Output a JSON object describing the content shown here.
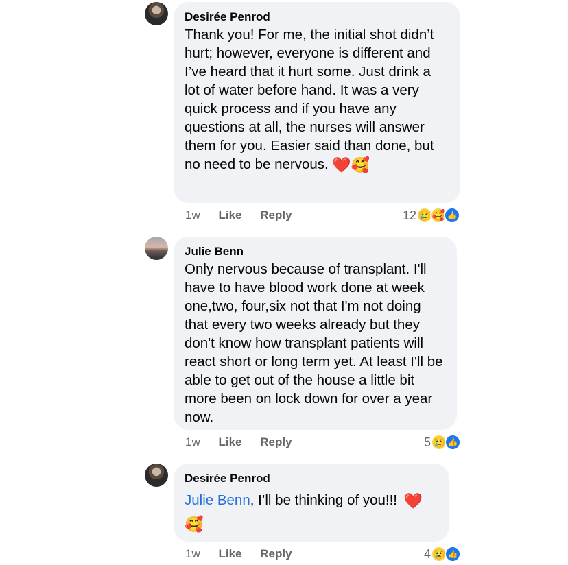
{
  "comments": [
    {
      "author": "Desirée Penrod",
      "text": "Thank you! For me, the initial shot didn’t hurt; however, everyone is different and I’ve heard that it hurt some. Just drink a lot of water before hand. It was a very quick process and if you have any questions at all, the nurses will answer them for you. Easier said than done, but no need to be nervous.",
      "emojis": "❤️🥰",
      "time": "1w",
      "like_label": "Like",
      "reply_label": "Reply",
      "reaction_count": "12",
      "reactions": [
        "sad-icon",
        "care-icon",
        "like-icon"
      ]
    },
    {
      "author": "Julie Benn",
      "text": "Only nervous because of transplant. I'll have to have blood work done at week one,two, four,six not that I'm not doing that every two weeks already but they don't know how transplant patients will react short or long term yet. At least I'll be able to get out of the house a little bit more been on lock down for over a year now.",
      "time": "1w",
      "like_label": "Like",
      "reply_label": "Reply",
      "reaction_count": "5",
      "reactions": [
        "sad-icon",
        "like-icon"
      ]
    },
    {
      "author": "Desirée Penrod",
      "mention": "Julie Benn",
      "text": ", I’ll be thinking of you!!!",
      "emoji1": "❤️",
      "emoji2": "🥰",
      "time": "1w",
      "like_label": "Like",
      "reply_label": "Reply",
      "reaction_count": "4",
      "reactions": [
        "sad-icon",
        "like-icon"
      ]
    }
  ],
  "colors": {
    "bubble": "#f0f2f5",
    "mention": "#216fdb",
    "meta": "#65676b",
    "like_blue": "#1877f2"
  }
}
